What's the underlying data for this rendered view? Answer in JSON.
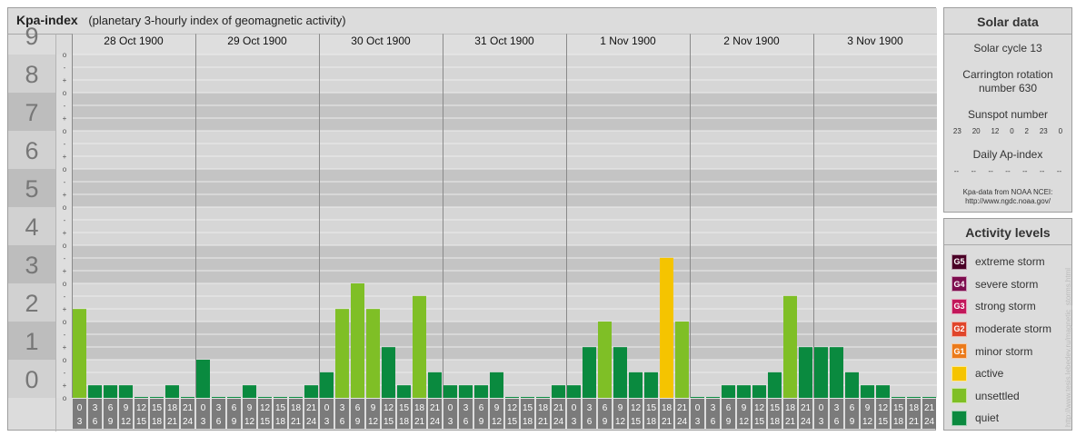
{
  "header": {
    "title": "Kpa-index",
    "subtitle": "(planetary 3-hourly index of geomagnetic activity)"
  },
  "solar_data": {
    "title": "Solar data",
    "solar_cycle": "Solar cycle 13",
    "carrington": "Carrington rotation number 630",
    "sunspot_label": "Sunspot number",
    "sunspots": [
      "23",
      "20",
      "12",
      "0",
      "2",
      "23",
      "0"
    ],
    "ap_label": "Daily Ap-index",
    "ap_values": [
      "--",
      "--",
      "--",
      "--",
      "--",
      "--",
      "--"
    ],
    "source_line1": "Kpa-data from NOAA NCEI:",
    "source_line2": "http://www.ngdc.noaa.gov/"
  },
  "activity_levels": {
    "title": "Activity levels",
    "items": [
      {
        "badge": "G5",
        "label": "extreme storm",
        "color": "#4a0026"
      },
      {
        "badge": "G4",
        "label": "severe storm",
        "color": "#7d0d4e"
      },
      {
        "badge": "G3",
        "label": "strong storm",
        "color": "#c2185b"
      },
      {
        "badge": "G2",
        "label": "moderate storm",
        "color": "#e0452a"
      },
      {
        "badge": "G1",
        "label": "minor storm",
        "color": "#eb7a1a"
      },
      {
        "badge": "",
        "label": "active",
        "color": "#f5c400"
      },
      {
        "badge": "",
        "label": "unsettled",
        "color": "#7fbf26"
      },
      {
        "badge": "",
        "label": "quiet",
        "color": "#0a8a3f"
      }
    ]
  },
  "watermark": "http://www.tesis.lebedev.ru/magnetic_storms.html",
  "chart_data": {
    "type": "bar",
    "title": "Kpa-index",
    "ylim": [
      0,
      9
    ],
    "y_major_ticks": [
      "0",
      "1",
      "2",
      "3",
      "4",
      "5",
      "6",
      "7",
      "8",
      "9"
    ],
    "y_minor_ticks": [
      "o",
      "+",
      "-",
      "o",
      "+",
      "-",
      "o",
      "+",
      "-",
      "o",
      "+",
      "-",
      "o",
      "+",
      "-",
      "o",
      "+",
      "-",
      "o",
      "+",
      "-",
      "o",
      "+",
      "-",
      "o",
      "+",
      "-",
      "o"
    ],
    "days": [
      "28 Oct 1900",
      "29 Oct 1900",
      "30 Oct 1900",
      "31 Oct 1900",
      "1 Nov 1900",
      "2 Nov 1900",
      "3 Nov 1900"
    ],
    "interval_start": [
      "0",
      "3",
      "6",
      "9",
      "12",
      "15",
      "18",
      "21"
    ],
    "interval_end": [
      "3",
      "6",
      "9",
      "12",
      "15",
      "18",
      "21",
      "24"
    ],
    "values": [
      [
        2.33,
        0.33,
        0.33,
        0.33,
        0,
        0,
        0.33,
        0
      ],
      [
        1,
        0,
        0,
        0.33,
        0,
        0,
        0,
        0.33
      ],
      [
        0.67,
        2.33,
        3,
        2.33,
        1.33,
        0.33,
        2.67,
        0.67
      ],
      [
        0.33,
        0.33,
        0.33,
        0.67,
        0,
        0,
        0,
        0.33
      ],
      [
        0.33,
        1.33,
        2,
        1.33,
        0.67,
        0.67,
        3.67,
        2
      ],
      [
        0,
        0,
        0.33,
        0.33,
        0.33,
        0.67,
        2.67,
        1.33
      ],
      [
        1.33,
        1.33,
        0.67,
        0.33,
        0.33,
        0,
        0,
        0
      ]
    ]
  }
}
